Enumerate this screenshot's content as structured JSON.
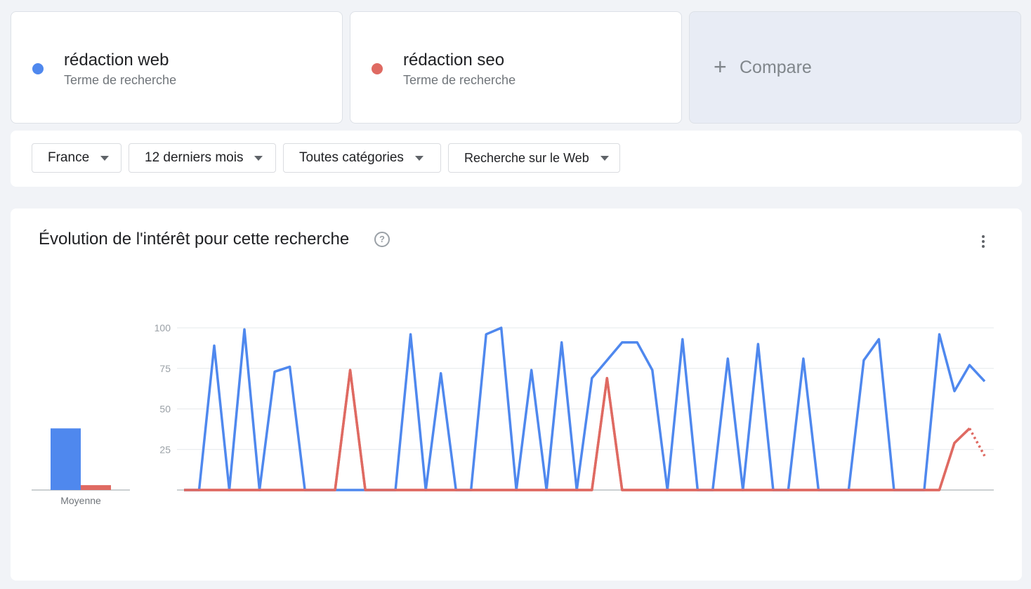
{
  "terms": [
    {
      "name": "rédaction web",
      "type": "Terme de recherche",
      "color": "#4f88ee"
    },
    {
      "name": "rédaction seo",
      "type": "Terme de recherche",
      "color": "#df6a62"
    }
  ],
  "compare": {
    "plus": "+",
    "label": "Compare"
  },
  "filters": [
    {
      "label": "France",
      "icon": "caret-down-icon"
    },
    {
      "label": "12 derniers mois",
      "icon": "caret-down-icon"
    },
    {
      "label": "Toutes catégories",
      "icon": "caret-down-icon"
    },
    {
      "label": "Recherche sur le Web",
      "icon": "caret-down-icon"
    }
  ],
  "chart_card": {
    "title": "Évolution de l'intérêt pour cette recherche",
    "help_icon": "help-circle-icon",
    "menu_icon": "more-vert-icon"
  },
  "chart_data": [
    {
      "type": "bar",
      "categories": [
        "rédaction web",
        "rédaction seo"
      ],
      "values": [
        38,
        3
      ],
      "xlabel": "Moyenne",
      "colors": [
        "#4f88ee",
        "#df6a62"
      ]
    },
    {
      "type": "line",
      "ylim": [
        0,
        100
      ],
      "yticks": [
        25,
        50,
        75,
        100
      ],
      "grid": true,
      "points": 53,
      "series": [
        {
          "name": "rédaction web",
          "color": "#4f88ee",
          "values": [
            0,
            0,
            89,
            0,
            99,
            0,
            73,
            76,
            0,
            0,
            0,
            0,
            0,
            0,
            0,
            96,
            0,
            72,
            0,
            0,
            96,
            100,
            0,
            74,
            0,
            91,
            0,
            69,
            80,
            91,
            91,
            74,
            0,
            93,
            0,
            0,
            81,
            0,
            90,
            0,
            0,
            81,
            0,
            0,
            0,
            80,
            93,
            0,
            0,
            0,
            96,
            61,
            77,
            67
          ]
        },
        {
          "name": "rédaction seo",
          "color": "#df6a62",
          "values": [
            0,
            0,
            0,
            0,
            0,
            0,
            0,
            0,
            0,
            0,
            0,
            74,
            0,
            0,
            0,
            0,
            0,
            0,
            0,
            0,
            0,
            0,
            0,
            0,
            0,
            0,
            0,
            0,
            69,
            0,
            0,
            0,
            0,
            0,
            0,
            0,
            0,
            0,
            0,
            0,
            0,
            0,
            0,
            0,
            0,
            0,
            0,
            0,
            0,
            0,
            0,
            29,
            38,
            21
          ],
          "partial_last": true
        }
      ]
    }
  ]
}
